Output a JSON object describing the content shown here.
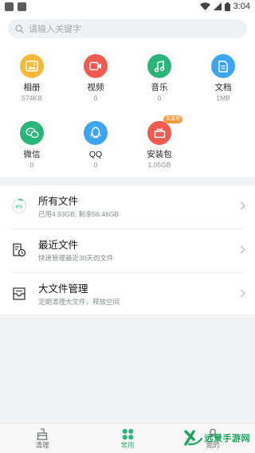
{
  "status_bar": {
    "time": "3:04"
  },
  "search": {
    "placeholder": "请输入关键字"
  },
  "categories": [
    {
      "label": "相册",
      "value": "574KB",
      "icon": "photo-icon",
      "color": "#f6b83a"
    },
    {
      "label": "视频",
      "value": "0",
      "icon": "video-icon",
      "color": "#f05a4f"
    },
    {
      "label": "音乐",
      "value": "0",
      "icon": "music-icon",
      "color": "#2bb57a"
    },
    {
      "label": "文档",
      "value": "1MB",
      "icon": "document-icon",
      "color": "#3da5f0"
    },
    {
      "label": "微信",
      "value": "0",
      "icon": "wechat-icon",
      "color": "#2bb57a"
    },
    {
      "label": "QQ",
      "value": "0",
      "icon": "qq-icon",
      "color": "#3da5f0"
    },
    {
      "label": "安装包",
      "value": "1.05GB",
      "icon": "apk-icon",
      "color": "#f05a4f",
      "badge": "去清理"
    }
  ],
  "rows": [
    {
      "title": "所有文件",
      "desc": "已用4.93GB, 剩余56.46GB",
      "icon": "storage-ring-icon",
      "ring_label": "8%",
      "usage_percent": 8
    },
    {
      "title": "最近文件",
      "desc": "快速管理最近30天的文件",
      "icon": "recent-files-icon"
    },
    {
      "title": "大文件管理",
      "desc": "定期清理大文件，释放空间",
      "icon": "large-files-icon"
    }
  ],
  "bottom_nav": [
    {
      "label": "清理",
      "icon": "broom-icon",
      "active": false
    },
    {
      "label": "常用",
      "icon": "grid-icon",
      "active": true
    },
    {
      "label": "我的",
      "icon": "person-icon",
      "active": false
    }
  ],
  "watermark": {
    "text": "远景手游网"
  },
  "colors": {
    "accent": "#2fb37a",
    "background": "#f2f3f5"
  }
}
